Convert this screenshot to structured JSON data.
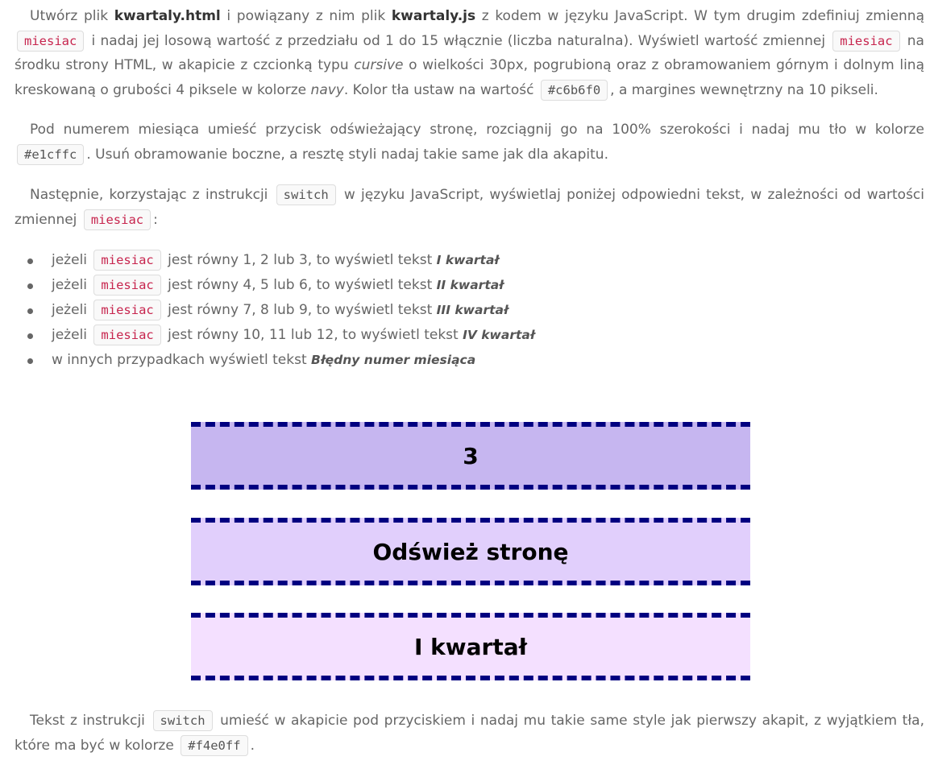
{
  "p1": {
    "t1": "Utwórz plik ",
    "file_html": "kwartaly.html",
    "t2": " i powiązany z nim plik ",
    "file_js": "kwartaly.js",
    "t3": " z kodem w języku JavaScript. W tym drugim zdefiniuj zmienną",
    "var1": "miesiac",
    "t4": " i nadaj jej losową wartość z przedziału od 1 do 15 włącznie (liczba naturalna). Wyświetl wartość zmiennej ",
    "var2": "miesiac",
    "t5": " na",
    "t6": "środku strony HTML, w akapicie z czcionką typu ",
    "font_type": "cursive",
    "t7": " o wielkości 30px, pogrubioną oraz z obramowaniem górnym i dolnym liną",
    "t8": "kreskowaną o grubości 4 piksele w kolorze ",
    "color_navy": "navy",
    "t9": ". Kolor tła ustaw na wartość ",
    "bg_color": "#c6b6f0",
    "t10": ", a margines wewnętrzny na 10 pikseli."
  },
  "p2": {
    "t1": "Pod numerem miesiąca umieść przycisk odświeżający stronę, rozciągnij go na 100% szerokości i nadaj mu tło w kolorze",
    "bg_color": "#e1cffc",
    "t2": ". Usuń obramowanie boczne, a resztę styli nadaj takie same jak dla akapitu."
  },
  "p3": {
    "t1": "Następnie, korzystając z instrukcji ",
    "switch_kw": "switch",
    "t2": " w języku JavaScript, wyświetlaj poniżej odpowiedni tekst, w zależności od wartości",
    "t3": "zmiennej ",
    "var": "miesiac",
    "t4": ":"
  },
  "conditions": [
    {
      "prefix": "jeżeli ",
      "var": "miesiac",
      "middle": " jest równy 1, 2 lub 3, to wyświetl tekst ",
      "result": "I kwartał"
    },
    {
      "prefix": "jeżeli ",
      "var": "miesiac",
      "middle": " jest równy 4, 5 lub 6, to wyświetl tekst ",
      "result": "II kwartał"
    },
    {
      "prefix": "jeżeli ",
      "var": "miesiac",
      "middle": " jest równy 7, 8 lub 9, to wyświetl tekst ",
      "result": "III kwartał"
    },
    {
      "prefix": "jeżeli ",
      "var": "miesiac",
      "middle": " jest równy 10, 11 lub 12, to wyświetl tekst ",
      "result": "IV kwartał"
    }
  ],
  "condition_else": {
    "text": "w innych przypadkach wyświetl tekst ",
    "result": "Błędny numer miesiąca"
  },
  "demo": {
    "month_value": "3",
    "refresh_label": "Odśwież stronę",
    "quarter_text": "I kwartał"
  },
  "p4": {
    "t1": "Tekst z instrukcji ",
    "switch_kw": "switch",
    "t2": " umieść w akapicie pod przyciskiem i nadaj mu takie same style jak pierwszy akapit, z wyjątkiem tła,",
    "t3": "które ma być w kolorze ",
    "bg_color": "#f4e0ff",
    "t4": "."
  },
  "colors": {
    "text": "#666666",
    "bold_text": "#333333",
    "code_text": "#c7254e",
    "code_bg": "#f9f9f9",
    "demo_border": "#000080",
    "demo_num_bg": "#c6b6f0",
    "demo_btn_bg": "#e1cffc",
    "demo_quarter_bg": "#f4e0ff"
  }
}
